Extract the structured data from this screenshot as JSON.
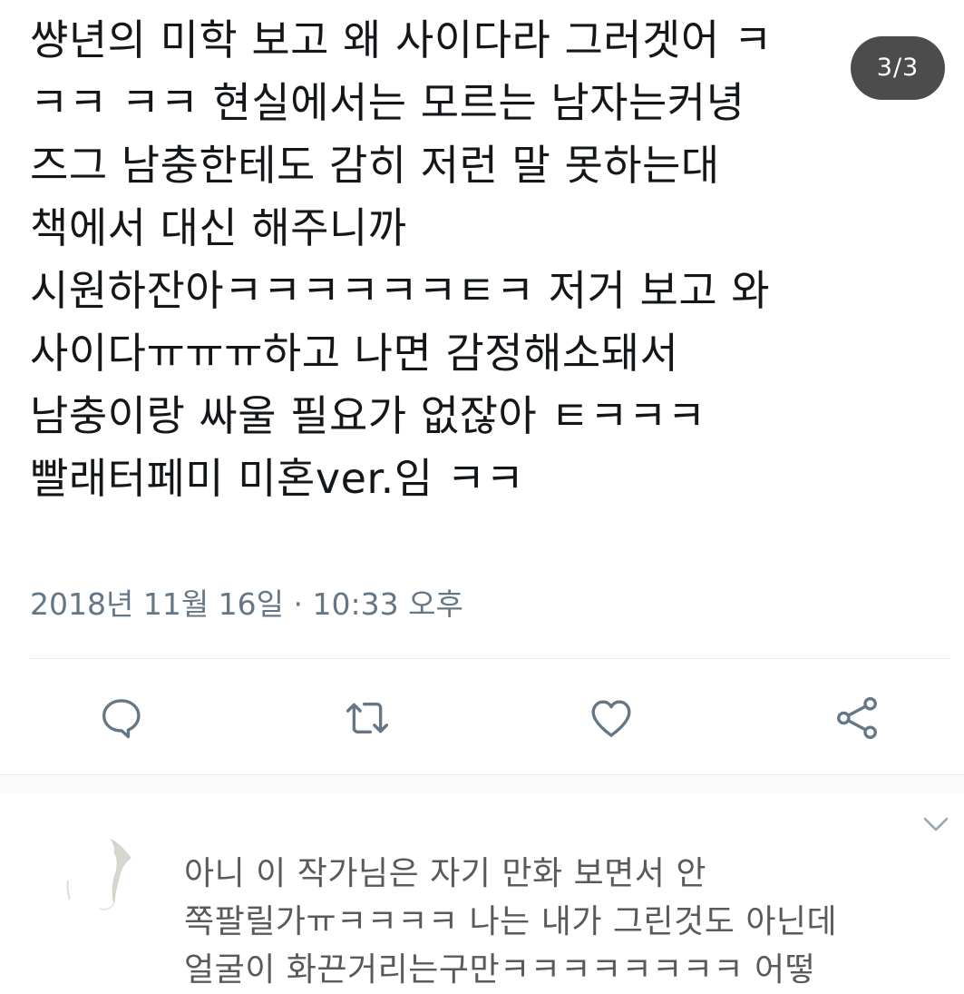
{
  "tweet": {
    "lines": [
      "썅년의 미학 보고 왜 사이다라 그러겟어 ㅋ",
      "ㅋㅋ ㅋㅋ 현실에서는 모르는 남자는커녕",
      "즈그 남충한테도 감히 저런 말 못하는대",
      "책에서 대신 해주니까",
      "시원하잔아ㅋㅋㅋㅋㅋㅋㅌㅋ 저거 보고 와",
      "사이다ㅠㅠㅠ하고 나면 감정해소돼서",
      "남충이랑 싸울 필요가 없잖아 ㅌㅋㅋㅋ",
      "빨래터페미 미혼ver.임 ㅋㅋ"
    ],
    "timestamp": "2018년 11월 16일 · 10:33 오후"
  },
  "page_badge": "3/3",
  "actions": {
    "reply_icon": "reply-bubble-icon",
    "retweet_icon": "retweet-icon",
    "like_icon": "heart-icon",
    "share_icon": "share-icon"
  },
  "reply": {
    "lines": [
      "아니 이 작가님은 자기 만화 보면서 안",
      "쪽팔릴가ㅠㅋㅋㅋㅋ 나는 내가 그린것도 아닌데",
      "얼굴이 화끈거리는구만ㅋㅋㅋㅋㅋㅋㅋㅋ 어떻"
    ]
  },
  "colors": {
    "text": "#14171a",
    "secondary": "#657786",
    "icon": "#657786",
    "badge_bg": "#2d2d2d"
  }
}
